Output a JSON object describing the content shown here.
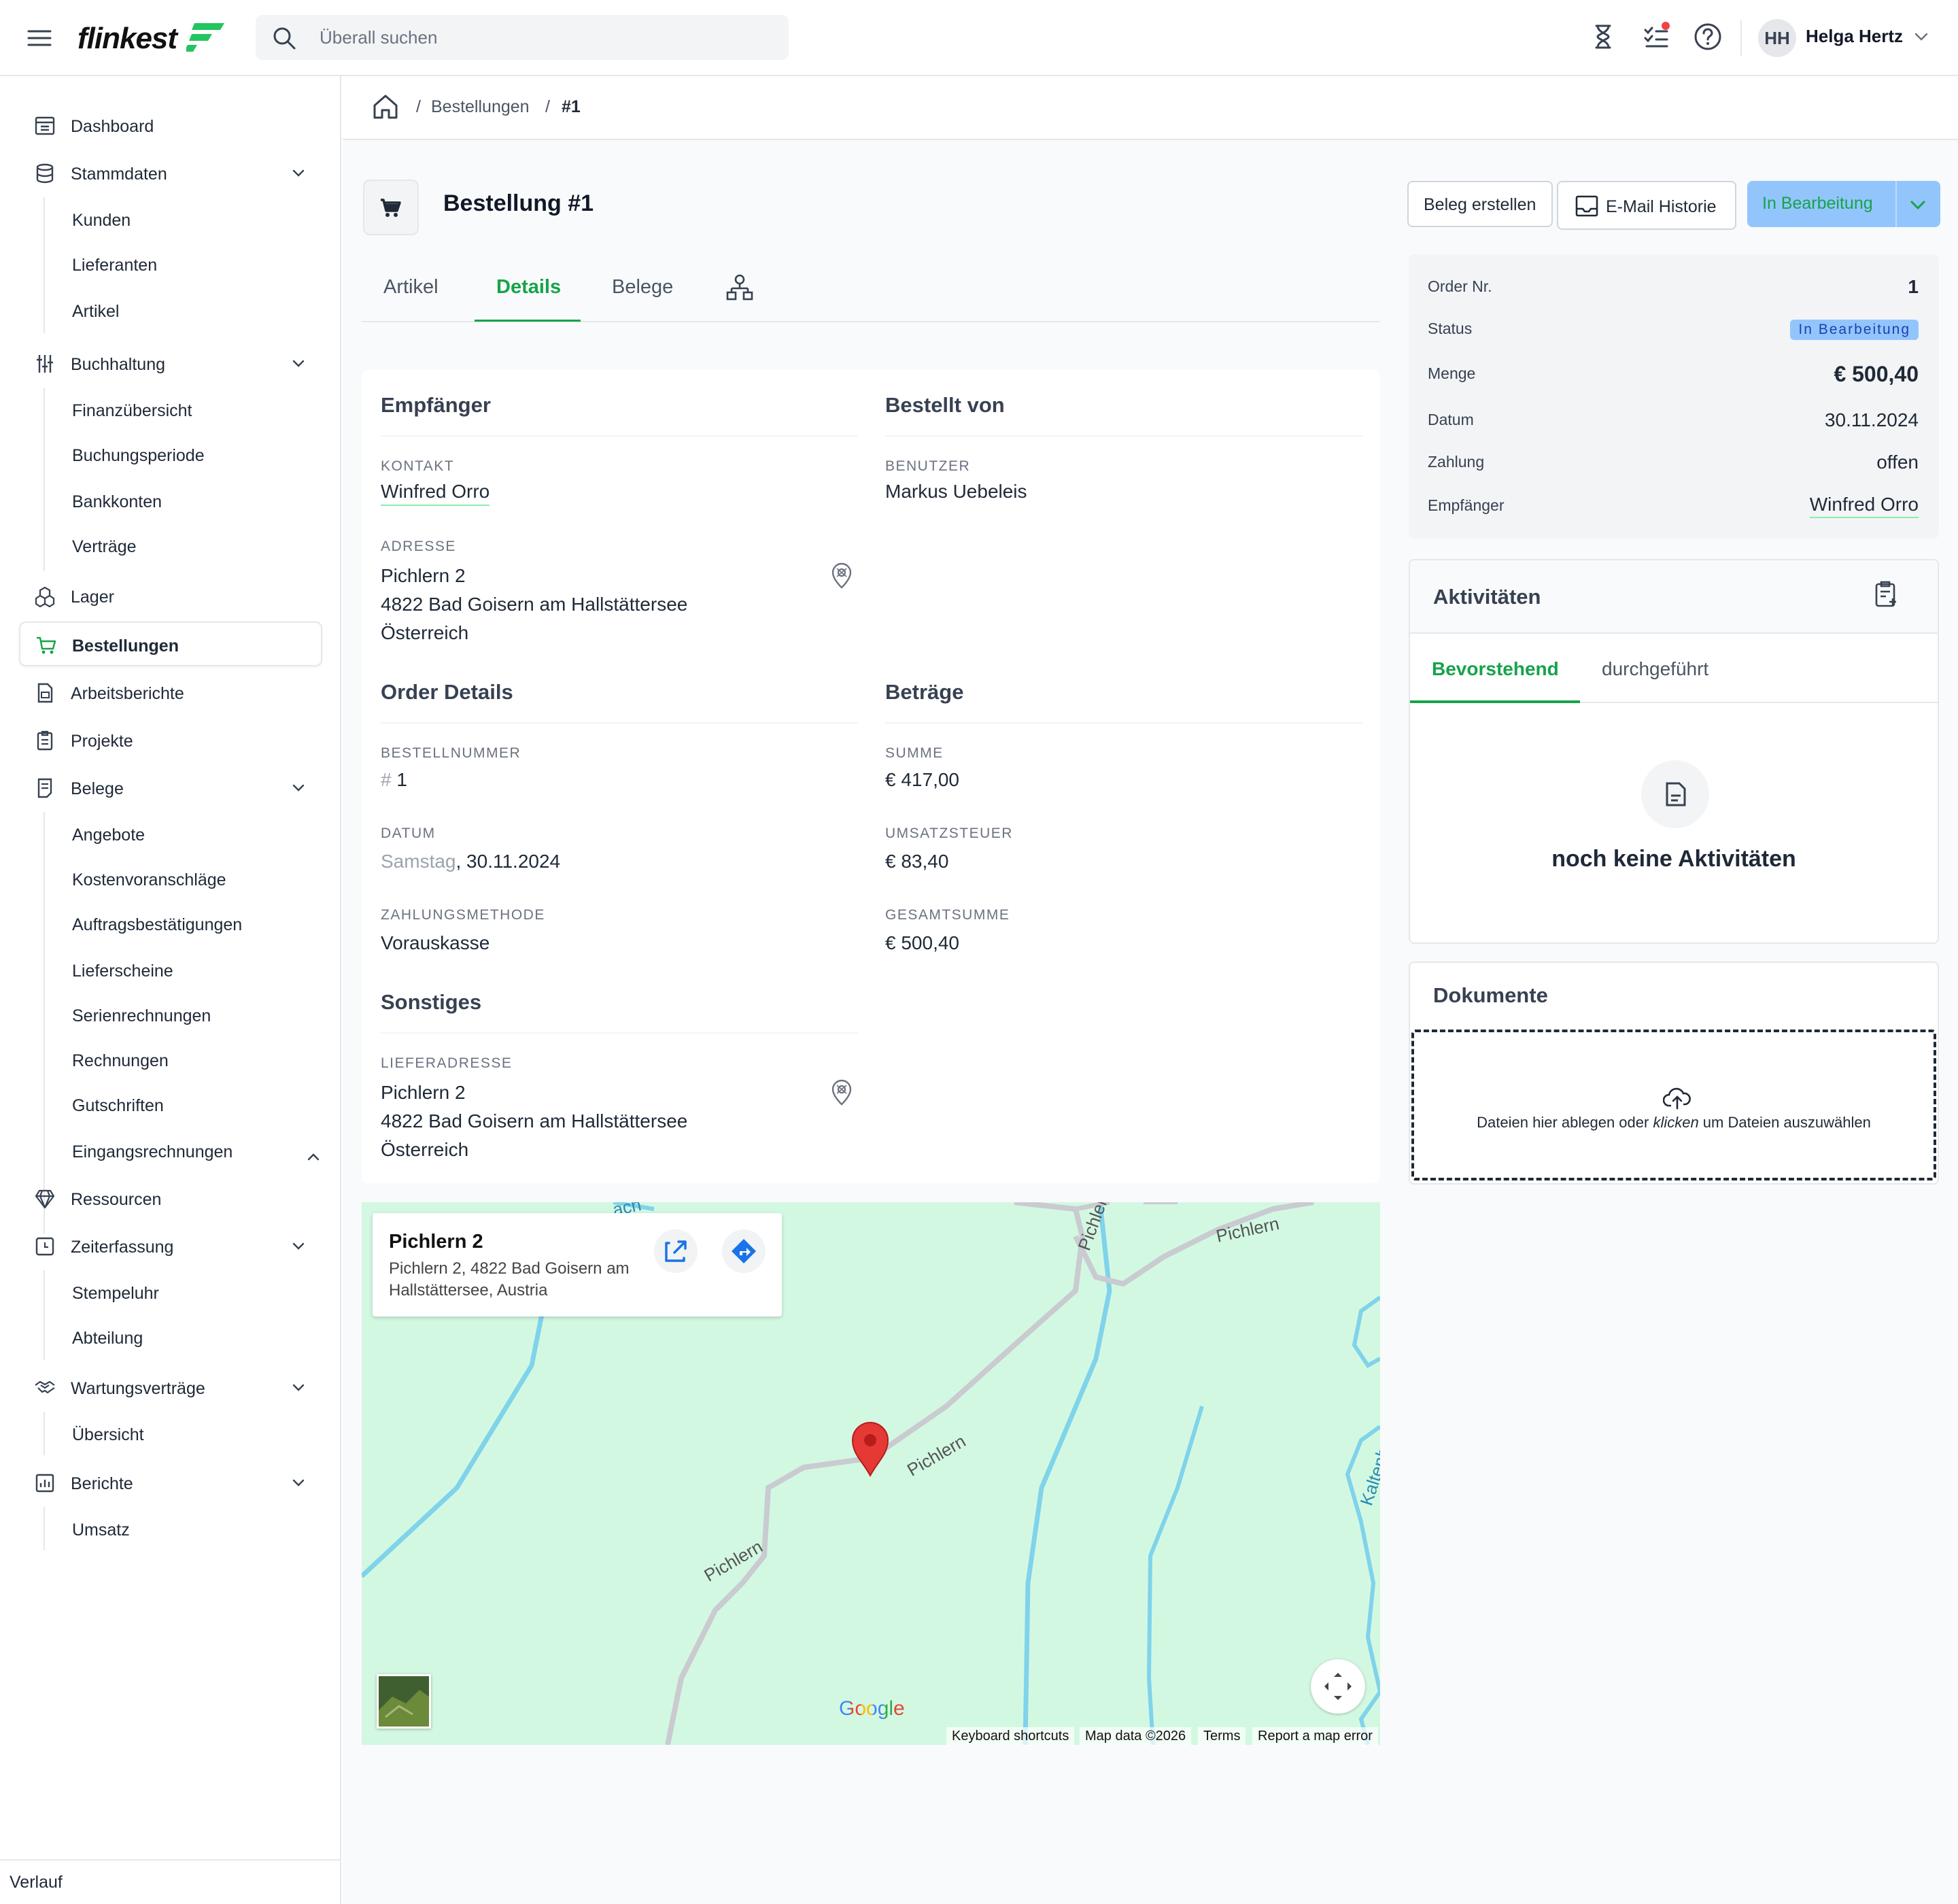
{
  "header": {
    "logo_text": "flinkest",
    "search_placeholder": "Überall suchen",
    "user_initials": "HH",
    "user_name": "Helga Hertz",
    "icons": [
      "hourglass-icon",
      "tasks-icon",
      "help-icon"
    ]
  },
  "sidebar": {
    "items": [
      {
        "label": "Dashboard",
        "icon": "dashboard-icon"
      },
      {
        "label": "Stammdaten",
        "icon": "database-icon"
      },
      {
        "label": "Kunden"
      },
      {
        "label": "Lieferanten"
      },
      {
        "label": "Artikel"
      },
      {
        "label": "Buchhaltung",
        "icon": "sliders-icon"
      },
      {
        "label": "Finanzübersicht"
      },
      {
        "label": "Buchungsperiode"
      },
      {
        "label": "Bankkonten"
      },
      {
        "label": "Verträge"
      },
      {
        "label": "Lager",
        "icon": "boxes-icon"
      },
      {
        "label": "Bestellungen",
        "icon": "cart-icon"
      },
      {
        "label": "Arbeitsberichte",
        "icon": "report-icon"
      },
      {
        "label": "Projekte",
        "icon": "clipboard-icon"
      },
      {
        "label": "Belege",
        "icon": "receipt-icon"
      },
      {
        "label": "Angebote"
      },
      {
        "label": "Kostenvoranschläge"
      },
      {
        "label": "Auftragsbestätigungen"
      },
      {
        "label": "Lieferscheine"
      },
      {
        "label": "Serienrechnungen"
      },
      {
        "label": "Rechnungen"
      },
      {
        "label": "Gutschriften"
      },
      {
        "label": "Eingangsrechnungen"
      },
      {
        "label": "Ressourcen",
        "icon": "diamond-icon"
      },
      {
        "label": "Zeiterfassung",
        "icon": "clock-icon"
      },
      {
        "label": "Stempeluhr"
      },
      {
        "label": "Abteilung"
      },
      {
        "label": "Wartungsverträge",
        "icon": "handshake-icon"
      },
      {
        "label": "Übersicht"
      },
      {
        "label": "Berichte",
        "icon": "chart-icon"
      },
      {
        "label": "Umsatz"
      }
    ],
    "footer": "Verlauf"
  },
  "breadcrumb": {
    "level1": "Bestellungen",
    "level2": "#1"
  },
  "page": {
    "title": "Bestellung #1"
  },
  "tabs": {
    "artikel": "Artikel",
    "details": "Details",
    "belege": "Belege"
  },
  "details": {
    "empfaenger": {
      "title": "Empfänger",
      "kontakt_label": "KONTAKT",
      "kontakt": "Winfred Orro",
      "adresse_label": "ADRESSE",
      "adresse_line1": "Pichlern 2",
      "adresse_line2": "4822 Bad Goisern am Hallstättersee",
      "adresse_line3": "Österreich"
    },
    "bestellt_von": {
      "title": "Bestellt von",
      "benutzer_label": "BENUTZER",
      "benutzer": "Markus Uebeleis"
    },
    "order": {
      "title": "Order Details",
      "nummer_label": "BESTELLNUMMER",
      "nummer_prefix": "#",
      "nummer": "1",
      "datum_label": "DATUM",
      "datum_weekday": "Samstag",
      "datum": ", 30.11.2024",
      "zahlung_label": "ZAHLUNGSMETHODE",
      "zahlung": "Vorauskasse"
    },
    "betraege": {
      "title": "Beträge",
      "summe_label": "SUMME",
      "summe": "€ 417,00",
      "ust_label": "UMSATZSTEUER",
      "ust": "€ 83,40",
      "gesamt_label": "GESAMTSUMME",
      "gesamt": "€ 500,40"
    },
    "sonstiges": {
      "title": "Sonstiges",
      "liefer_label": "LIEFERADRESSE",
      "liefer_line1": "Pichlern 2",
      "liefer_line2": "4822 Bad Goisern am Hallstättersee",
      "liefer_line3": "Österreich"
    }
  },
  "map": {
    "card_title": "Pichlern 2",
    "card_subtitle": "Pichlern 2, 4822 Bad Goisern am Hallstättersee, Austria",
    "road_labels": [
      "Pichlern",
      "Pichlern",
      "Pichlern",
      "Pichler",
      "Kaltenbach",
      "ach"
    ],
    "google": "Google",
    "attr_shortcuts": "Keyboard shortcuts",
    "attr_data": "Map data ©2026",
    "attr_terms": "Terms",
    "attr_report": "Report a map error"
  },
  "actions": {
    "beleg": "Beleg erstellen",
    "email": "E-Mail Historie",
    "status": "In Bearbeitung"
  },
  "summary": {
    "order_label": "Order Nr.",
    "order_value": "1",
    "status_label": "Status",
    "status_value": "In Bearbeitung",
    "menge_label": "Menge",
    "menge_value": "€ 500,40",
    "datum_label": "Datum",
    "datum_value": "30.11.2024",
    "zahlung_label": "Zahlung",
    "zahlung_value": "offen",
    "empf_label": "Empfänger",
    "empf_value": "Winfred Orro"
  },
  "activities": {
    "title": "Aktivitäten",
    "tab_upcoming": "Bevorstehend",
    "tab_done": "durchgeführt",
    "empty": "noch keine Aktivitäten"
  },
  "documents": {
    "title": "Dokumente",
    "drop_before": "Dateien hier ablegen oder ",
    "drop_em": "klicken",
    "drop_after": " um Dateien auszuwählen"
  },
  "colors": {
    "accent": "#16a34a",
    "status": "#93c5fd",
    "map_bg": "#d3f8e2",
    "water": "#7fd3ea",
    "pin": "#e53935"
  }
}
